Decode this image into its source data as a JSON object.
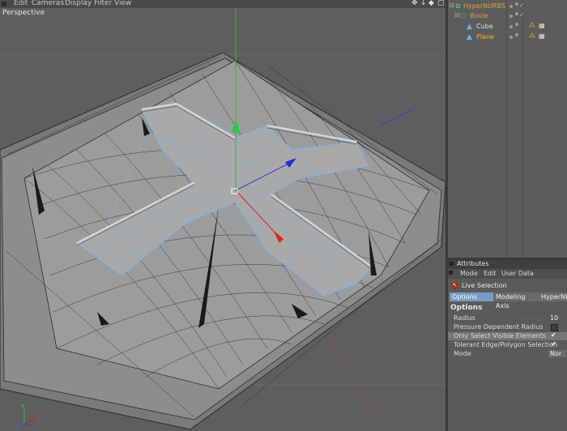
{
  "viewport": {
    "menus": [
      "Edit",
      "Cameras",
      "Display",
      "Filter",
      "View"
    ],
    "controls": [
      "✥",
      "↓",
      "◆",
      "▢"
    ],
    "label": "Perspective"
  },
  "objects": [
    {
      "name": "HyperNURBS",
      "color": "#e0a040"
    },
    {
      "name": "Boole",
      "color": "#e0a040"
    },
    {
      "name": "Cube",
      "color": "#e0e0e0"
    },
    {
      "name": "Plane",
      "color": "#f0b030"
    }
  ],
  "attributes": {
    "title": "Attributes",
    "menu": [
      "Mode",
      "Edit",
      "User Data"
    ],
    "tool": "Live Selection",
    "tabs": [
      "Options",
      "Modeling Axis",
      "HyperNU"
    ],
    "section": "Options",
    "props": {
      "radius_label": "Radius",
      "radius_value": "10",
      "pressure_label": "Pressure Dependent Radius",
      "visible_label": "Only Select Visible Elements",
      "tolerant_label": "Tolerant Edge/Polygon Selection",
      "mode_label": "Mode",
      "mode_value": "Nor"
    }
  },
  "colors": {
    "selection": "#7a9ac4",
    "x_axis": "#d02020",
    "y_axis": "#20c040",
    "z_axis": "#3040d0"
  }
}
